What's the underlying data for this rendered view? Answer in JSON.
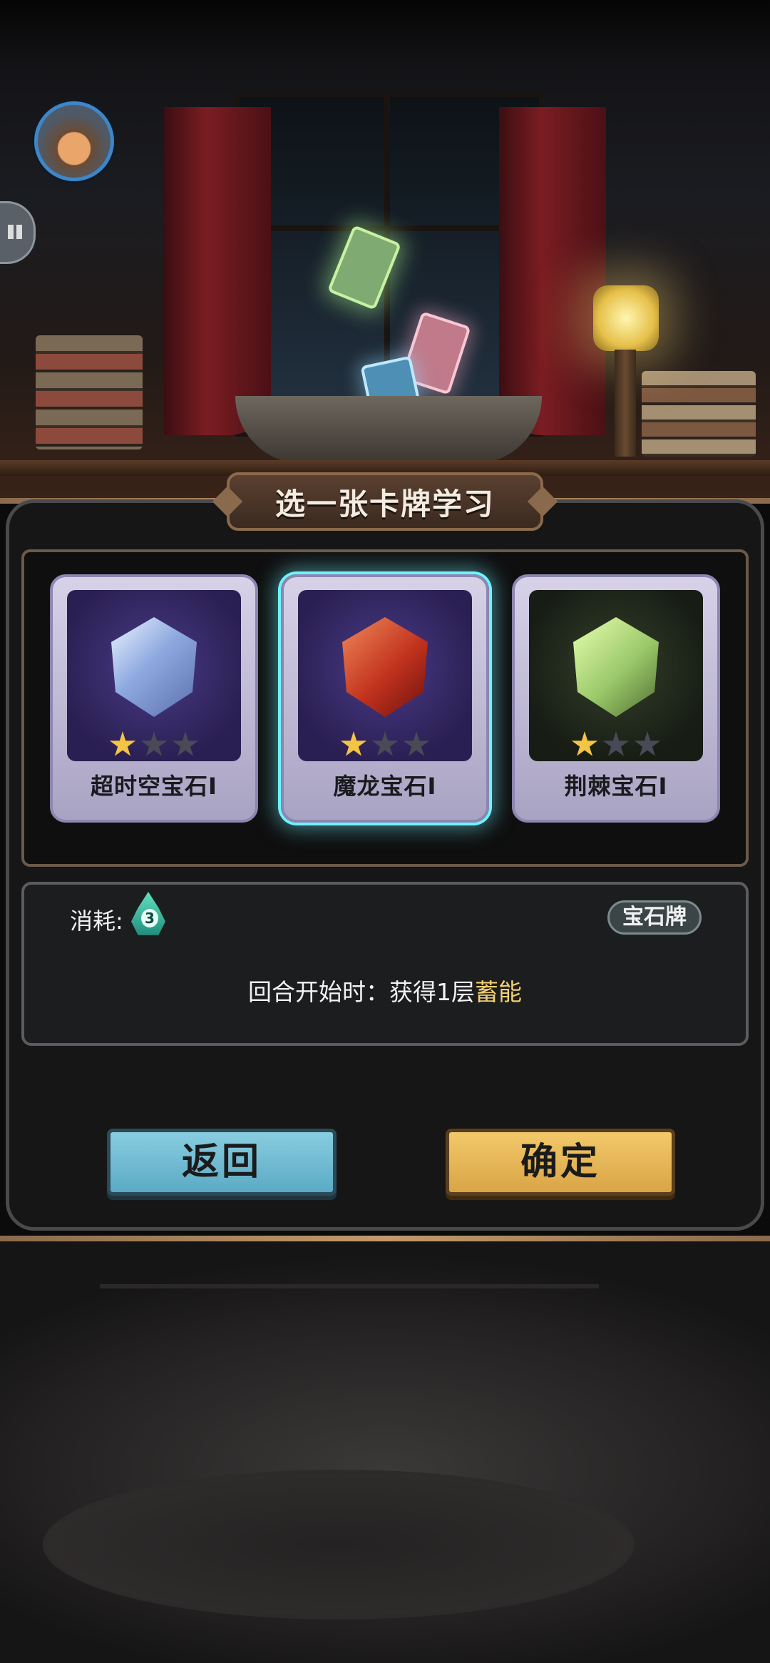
{
  "title": "选一张卡牌学习",
  "cards": [
    {
      "name": "超时空宝石I",
      "stars": 1,
      "max_stars": 3,
      "selected": false,
      "gem": "blue-gem-icon"
    },
    {
      "name": "魔龙宝石I",
      "stars": 1,
      "max_stars": 3,
      "selected": true,
      "gem": "red-dragon-gem-icon"
    },
    {
      "name": "荆棘宝石I",
      "stars": 1,
      "max_stars": 3,
      "selected": false,
      "gem": "green-thorn-gem-icon"
    }
  ],
  "detail": {
    "cost_label": "消耗:",
    "cost_value": "3",
    "type_tag": "宝石牌",
    "effect_prefix": "回合开始时：获得1层",
    "effect_highlight": "蓄能"
  },
  "buttons": {
    "back": "返回",
    "confirm": "确定"
  },
  "colors": {
    "selected_glow": "#6ff2ff",
    "back_button": "#6ab9d0",
    "confirm_button": "#e6b858",
    "highlight_text": "#f2cf73"
  }
}
